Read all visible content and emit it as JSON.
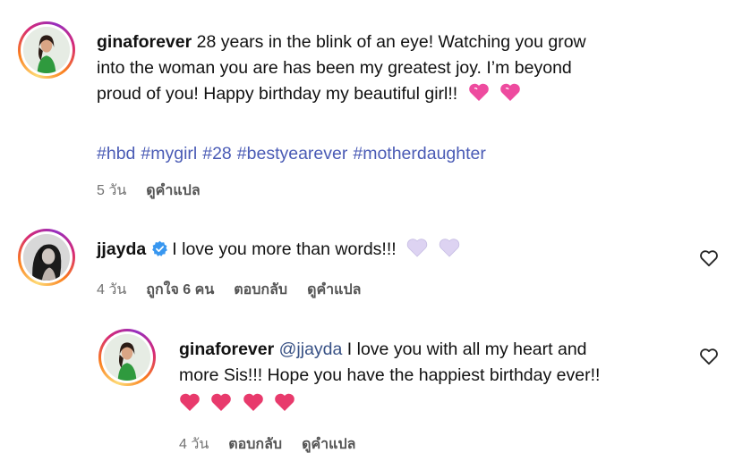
{
  "comments": [
    {
      "username": "ginaforever",
      "text_line1": "28 years in the blink of an eye! Watching you grow",
      "text_line2": "into the woman you are has been my greatest joy. I’m beyond",
      "text_line3": "proud of you! Happy birthday my beautiful girl!!",
      "emoji": "sparkling-heart x2",
      "hashtags": [
        "#hbd",
        "#mygirl",
        "#28",
        "#bestyearever",
        "#motherdaughter"
      ],
      "time": "5 วัน",
      "translate": "ดูคำแปล"
    },
    {
      "username": "jjayda",
      "verified": true,
      "text": "I love you more than words!!!",
      "emoji": "white-heart x2",
      "time": "4 วัน",
      "likes": "ถูกใจ 6 คน",
      "reply": "ตอบกลับ",
      "translate": "ดูคำแปล"
    },
    {
      "username": "ginaforever",
      "mention": "@jjayda",
      "text_line1": "I love you with all my heart and",
      "text_line2": "more Sis!!! Hope you have the happiest birthday ever!!",
      "emoji": "red-heart x4",
      "time": "4 วัน",
      "reply": "ตอบกลับ",
      "translate": "ดูคำแปล"
    }
  ],
  "colors": {
    "hashtag": "#4a5bb5",
    "meta": "#737373",
    "verified": "#3897f0",
    "pink_heart": "#e8449a",
    "white_heart": "#d9d0f0",
    "red_heart": "#e23a6a"
  }
}
